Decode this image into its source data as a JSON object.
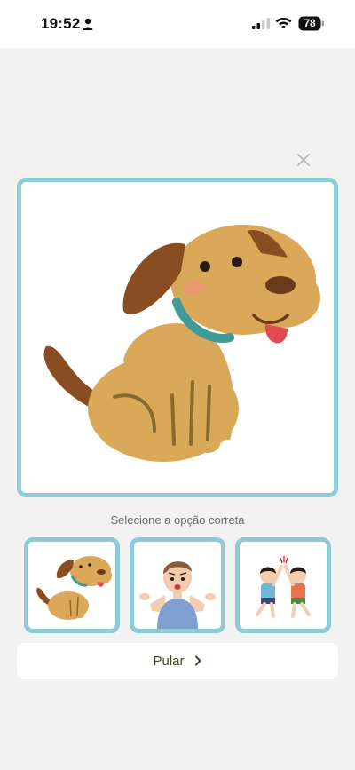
{
  "status_bar": {
    "time": "19:52",
    "battery": "78"
  },
  "quiz": {
    "prompt": "Selecione a opção correta",
    "options": [
      {
        "icon": "dog-illustration"
      },
      {
        "icon": "confused-man-illustration"
      },
      {
        "icon": "kids-high-five-illustration"
      }
    ]
  },
  "skip": {
    "label": "Pular"
  },
  "colors": {
    "card_border": "#8fcbd7",
    "background": "#f2f2f2",
    "dog_fur": "#d9a858",
    "dog_ear": "#8a4d22"
  }
}
